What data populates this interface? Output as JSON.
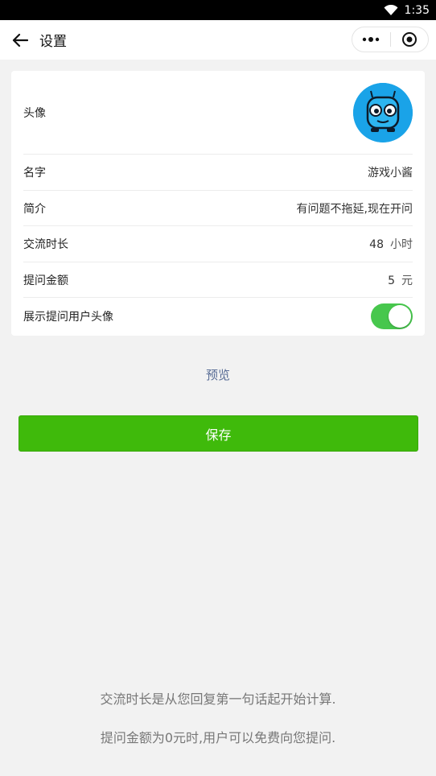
{
  "status_bar": {
    "time": "1:35",
    "wifi_icon": "wifi-icon"
  },
  "nav": {
    "title": "设置",
    "back_icon": "arrow-left-icon",
    "more_icon": "more-dots-icon",
    "close_icon": "target-circle-icon"
  },
  "settings": {
    "avatar_label": "头像",
    "rows": [
      {
        "label": "名字",
        "value": "游戏小酱",
        "unit": ""
      },
      {
        "label": "简介",
        "value": "有问题不拖延,现在开问",
        "unit": ""
      },
      {
        "label": "交流时长",
        "value": "48",
        "unit": "小时"
      },
      {
        "label": "提问金额",
        "value": "5",
        "unit": "元"
      }
    ],
    "toggle_label": "展示提问用户头像",
    "toggle_on": true
  },
  "preview_label": "预览",
  "save_label": "保存",
  "notes": [
    "交流时长是从您回复第一句话起开始计算.",
    "提问金额为0元时,用户可以免费向您提问."
  ],
  "colors": {
    "accent_green": "#3fba0b",
    "toggle_green": "#47c74d",
    "link_blue": "#576b95",
    "avatar_blue": "#1aa3e8"
  }
}
